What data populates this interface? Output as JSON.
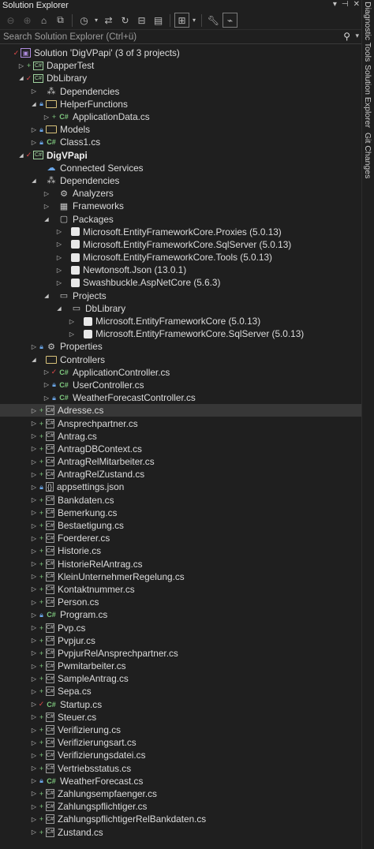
{
  "window": {
    "title": "Solution Explorer",
    "title_buttons": [
      "▾",
      "⊣",
      "✕"
    ]
  },
  "search": {
    "placeholder": "Search Solution Explorer (Ctrl+ü)"
  },
  "side_tabs": [
    "Diagnostic Tools",
    "Solution Explorer",
    "Git Changes"
  ],
  "tree": [
    {
      "label": "Solution 'DigVPapi' (3 of 3 projects)",
      "indent": 0,
      "exp": "",
      "mk": "check",
      "icon": "sln",
      "bold": false
    },
    {
      "label": "DapperTest",
      "indent": 1,
      "exp": "right",
      "mk": "plus",
      "icon": "proj",
      "bold": false
    },
    {
      "label": "DbLibrary",
      "indent": 1,
      "exp": "down",
      "mk": "check",
      "icon": "proj",
      "bold": false
    },
    {
      "label": "Dependencies",
      "indent": 2,
      "exp": "right",
      "mk": "",
      "icon": "deps",
      "bold": false
    },
    {
      "label": "HelperFunctions",
      "indent": 2,
      "exp": "down",
      "mk": "lock",
      "icon": "folder",
      "bold": false
    },
    {
      "label": "ApplicationData.cs",
      "indent": 3,
      "exp": "right",
      "mk": "plus",
      "icon": "cs",
      "bold": false
    },
    {
      "label": "Models",
      "indent": 2,
      "exp": "right",
      "mk": "lock",
      "icon": "folder",
      "bold": false
    },
    {
      "label": "Class1.cs",
      "indent": 2,
      "exp": "right",
      "mk": "lock",
      "icon": "cs",
      "bold": false
    },
    {
      "label": "DigVPapi",
      "indent": 1,
      "exp": "down",
      "mk": "check",
      "icon": "proj",
      "bold": true
    },
    {
      "label": "Connected Services",
      "indent": 2,
      "exp": "",
      "mk": "",
      "icon": "globe",
      "bold": false
    },
    {
      "label": "Dependencies",
      "indent": 2,
      "exp": "down",
      "mk": "",
      "icon": "deps",
      "bold": false
    },
    {
      "label": "Analyzers",
      "indent": 3,
      "exp": "right",
      "mk": "",
      "icon": "analyzer",
      "bold": false
    },
    {
      "label": "Frameworks",
      "indent": 3,
      "exp": "right",
      "mk": "",
      "icon": "framework",
      "bold": false
    },
    {
      "label": "Packages",
      "indent": 3,
      "exp": "down",
      "mk": "",
      "icon": "pkgs",
      "bold": false
    },
    {
      "label": "Microsoft.EntityFrameworkCore.Proxies (5.0.13)",
      "indent": 4,
      "exp": "right",
      "mk": "",
      "icon": "pkg",
      "bold": false
    },
    {
      "label": "Microsoft.EntityFrameworkCore.SqlServer (5.0.13)",
      "indent": 4,
      "exp": "right",
      "mk": "",
      "icon": "pkg",
      "bold": false
    },
    {
      "label": "Microsoft.EntityFrameworkCore.Tools (5.0.13)",
      "indent": 4,
      "exp": "right",
      "mk": "",
      "icon": "pkg",
      "bold": false
    },
    {
      "label": "Newtonsoft.Json (13.0.1)",
      "indent": 4,
      "exp": "right",
      "mk": "",
      "icon": "pkg",
      "bold": false
    },
    {
      "label": "Swashbuckle.AspNetCore (5.6.3)",
      "indent": 4,
      "exp": "right",
      "mk": "",
      "icon": "pkg",
      "bold": false
    },
    {
      "label": "Projects",
      "indent": 3,
      "exp": "down",
      "mk": "",
      "icon": "projs",
      "bold": false
    },
    {
      "label": "DbLibrary",
      "indent": 4,
      "exp": "down",
      "mk": "",
      "icon": "projs",
      "bold": false
    },
    {
      "label": "Microsoft.EntityFrameworkCore (5.0.13)",
      "indent": 5,
      "exp": "right",
      "mk": "",
      "icon": "pkg",
      "bold": false
    },
    {
      "label": "Microsoft.EntityFrameworkCore.SqlServer (5.0.13)",
      "indent": 5,
      "exp": "right",
      "mk": "",
      "icon": "pkg",
      "bold": false
    },
    {
      "label": "Properties",
      "indent": 2,
      "exp": "right",
      "mk": "lock",
      "icon": "props",
      "bold": false
    },
    {
      "label": "Controllers",
      "indent": 2,
      "exp": "down",
      "mk": "",
      "icon": "folder",
      "bold": false
    },
    {
      "label": "ApplicationController.cs",
      "indent": 3,
      "exp": "right",
      "mk": "check",
      "icon": "cs",
      "bold": false
    },
    {
      "label": "UserController.cs",
      "indent": 3,
      "exp": "right",
      "mk": "lock",
      "icon": "cs",
      "bold": false
    },
    {
      "label": "WeatherForecastController.cs",
      "indent": 3,
      "exp": "right",
      "mk": "lock",
      "icon": "cs",
      "bold": false
    },
    {
      "label": "Adresse.cs",
      "indent": 2,
      "exp": "right",
      "mk": "plus",
      "icon": "csfile",
      "bold": false,
      "selected": true
    },
    {
      "label": "Ansprechpartner.cs",
      "indent": 2,
      "exp": "right",
      "mk": "plus",
      "icon": "csfile",
      "bold": false
    },
    {
      "label": "Antrag.cs",
      "indent": 2,
      "exp": "right",
      "mk": "plus",
      "icon": "csfile",
      "bold": false
    },
    {
      "label": "AntragDBContext.cs",
      "indent": 2,
      "exp": "right",
      "mk": "plus",
      "icon": "csfile",
      "bold": false
    },
    {
      "label": "AntragRelMitarbeiter.cs",
      "indent": 2,
      "exp": "right",
      "mk": "plus",
      "icon": "csfile",
      "bold": false
    },
    {
      "label": "AntragRelZustand.cs",
      "indent": 2,
      "exp": "right",
      "mk": "plus",
      "icon": "csfile",
      "bold": false
    },
    {
      "label": "appsettings.json",
      "indent": 2,
      "exp": "right",
      "mk": "lock",
      "icon": "json",
      "bold": false
    },
    {
      "label": "Bankdaten.cs",
      "indent": 2,
      "exp": "right",
      "mk": "plus",
      "icon": "csfile",
      "bold": false
    },
    {
      "label": "Bemerkung.cs",
      "indent": 2,
      "exp": "right",
      "mk": "plus",
      "icon": "csfile",
      "bold": false
    },
    {
      "label": "Bestaetigung.cs",
      "indent": 2,
      "exp": "right",
      "mk": "plus",
      "icon": "csfile",
      "bold": false
    },
    {
      "label": "Foerderer.cs",
      "indent": 2,
      "exp": "right",
      "mk": "plus",
      "icon": "csfile",
      "bold": false
    },
    {
      "label": "Historie.cs",
      "indent": 2,
      "exp": "right",
      "mk": "plus",
      "icon": "csfile",
      "bold": false
    },
    {
      "label": "HistorieRelAntrag.cs",
      "indent": 2,
      "exp": "right",
      "mk": "plus",
      "icon": "csfile",
      "bold": false
    },
    {
      "label": "KleinUnternehmerRegelung.cs",
      "indent": 2,
      "exp": "right",
      "mk": "plus",
      "icon": "csfile",
      "bold": false
    },
    {
      "label": "Kontaktnummer.cs",
      "indent": 2,
      "exp": "right",
      "mk": "plus",
      "icon": "csfile",
      "bold": false
    },
    {
      "label": "Person.cs",
      "indent": 2,
      "exp": "right",
      "mk": "plus",
      "icon": "csfile",
      "bold": false
    },
    {
      "label": "Program.cs",
      "indent": 2,
      "exp": "right",
      "mk": "lock",
      "icon": "cs",
      "bold": false
    },
    {
      "label": "Pvp.cs",
      "indent": 2,
      "exp": "right",
      "mk": "plus",
      "icon": "csfile",
      "bold": false
    },
    {
      "label": "Pvpjur.cs",
      "indent": 2,
      "exp": "right",
      "mk": "plus",
      "icon": "csfile",
      "bold": false
    },
    {
      "label": "PvpjurRelAnsprechpartner.cs",
      "indent": 2,
      "exp": "right",
      "mk": "plus",
      "icon": "csfile",
      "bold": false
    },
    {
      "label": "Pwmitarbeiter.cs",
      "indent": 2,
      "exp": "right",
      "mk": "plus",
      "icon": "csfile",
      "bold": false
    },
    {
      "label": "SampleAntrag.cs",
      "indent": 2,
      "exp": "right",
      "mk": "plus",
      "icon": "csfile",
      "bold": false
    },
    {
      "label": "Sepa.cs",
      "indent": 2,
      "exp": "right",
      "mk": "plus",
      "icon": "csfile",
      "bold": false
    },
    {
      "label": "Startup.cs",
      "indent": 2,
      "exp": "right",
      "mk": "check",
      "icon": "cs",
      "bold": false
    },
    {
      "label": "Steuer.cs",
      "indent": 2,
      "exp": "right",
      "mk": "plus",
      "icon": "csfile",
      "bold": false
    },
    {
      "label": "Verifizierung.cs",
      "indent": 2,
      "exp": "right",
      "mk": "plus",
      "icon": "csfile",
      "bold": false
    },
    {
      "label": "Verifizierungsart.cs",
      "indent": 2,
      "exp": "right",
      "mk": "plus",
      "icon": "csfile",
      "bold": false
    },
    {
      "label": "Verifizierungsdatei.cs",
      "indent": 2,
      "exp": "right",
      "mk": "plus",
      "icon": "csfile",
      "bold": false
    },
    {
      "label": "Vertriebsstatus.cs",
      "indent": 2,
      "exp": "right",
      "mk": "plus",
      "icon": "csfile",
      "bold": false
    },
    {
      "label": "WeatherForecast.cs",
      "indent": 2,
      "exp": "right",
      "mk": "lock",
      "icon": "cs",
      "bold": false
    },
    {
      "label": "Zahlungsempfaenger.cs",
      "indent": 2,
      "exp": "right",
      "mk": "plus",
      "icon": "csfile",
      "bold": false
    },
    {
      "label": "Zahlungspflichtiger.cs",
      "indent": 2,
      "exp": "right",
      "mk": "plus",
      "icon": "csfile",
      "bold": false
    },
    {
      "label": "ZahlungspflichtigerRelBankdaten.cs",
      "indent": 2,
      "exp": "right",
      "mk": "plus",
      "icon": "csfile",
      "bold": false
    },
    {
      "label": "Zustand.cs",
      "indent": 2,
      "exp": "right",
      "mk": "plus",
      "icon": "csfile",
      "bold": false
    }
  ]
}
